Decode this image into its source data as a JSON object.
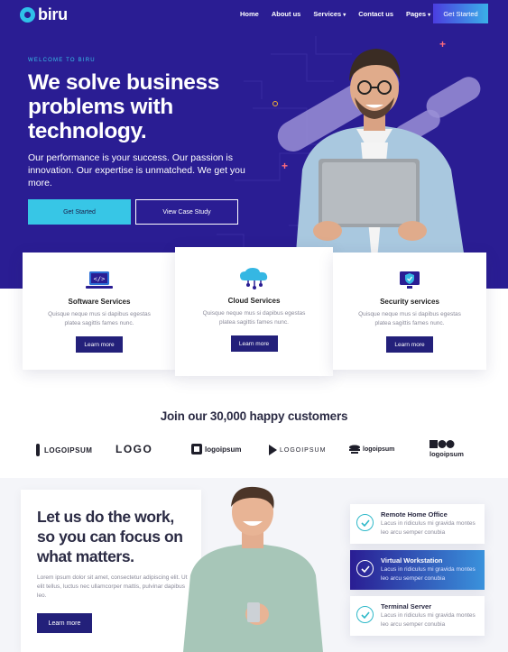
{
  "brand": {
    "name": "biru"
  },
  "nav": {
    "links": [
      {
        "label": "Home",
        "dropdown": false
      },
      {
        "label": "About us",
        "dropdown": false
      },
      {
        "label": "Services",
        "dropdown": true
      },
      {
        "label": "Contact us",
        "dropdown": false
      },
      {
        "label": "Pages",
        "dropdown": true
      }
    ],
    "cta": "Get Started"
  },
  "hero": {
    "eyebrow": "WELCOME TO BIRU",
    "headline": "We solve business problems with technology.",
    "subtext": "Our performance is your success. Our passion is innovation. Our expertise is unmatched. We get you more.",
    "primary_button": "Get Started",
    "secondary_button": "View Case Study"
  },
  "services": [
    {
      "icon": "laptop-code-icon",
      "title": "Software Services",
      "text": "Quisque neque mus si dapibus egestas platea sagittis fames nunc.",
      "button": "Learn more"
    },
    {
      "icon": "cloud-network-icon",
      "title": "Cloud Services",
      "text": "Quisque neque mus si dapibus egestas platea sagittis fames nunc.",
      "button": "Learn more"
    },
    {
      "icon": "shield-monitor-icon",
      "title": "Security services",
      "text": "Quisque neque mus si dapibus egestas platea sagittis fames nunc.",
      "button": "Learn more"
    }
  ],
  "customers": {
    "title": "Join our 30,000 happy customers",
    "logos": [
      "LOGOIPSUM",
      "LOGO",
      "logoipsum",
      "LOGOIPSUM",
      "logoipsum",
      "logoipsum"
    ]
  },
  "work": {
    "title": "Let us do the work, so you can focus on what matters.",
    "text": "Lorem ipsum dolor sit amet, consectetur adipiscing elit. Ut elit tellus, luctus nec ullamcorper mattis, pulvinar dapibus leo.",
    "button": "Learn more"
  },
  "features": [
    {
      "title": "Remote Home Office",
      "text": "Lacus in ridiculus mi gravida montes leo arcu semper conubia",
      "active": false
    },
    {
      "title": "Virtual Workstation",
      "text": "Lacus in ridiculus mi gravida montes leo arcu semper conubia",
      "active": true
    },
    {
      "title": "Terminal Server",
      "text": "Lacus in ridiculus mi gravida montes leo arcu semper conubia",
      "active": false
    }
  ],
  "colors": {
    "primary": "#2a1d93",
    "accent": "#37c6e6",
    "button_dark": "#23207a"
  }
}
